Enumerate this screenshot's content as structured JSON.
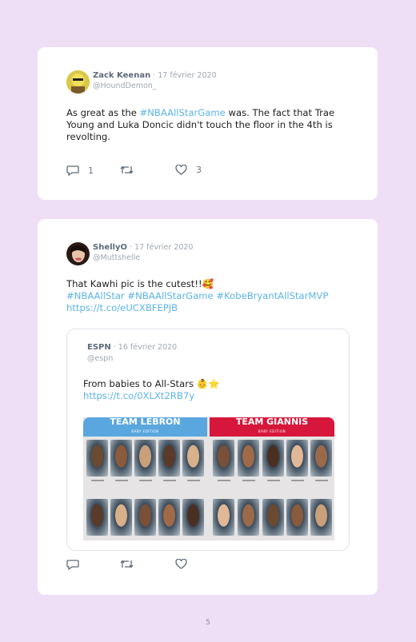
{
  "tweets": [
    {
      "name": "Zack Keenan",
      "date": " · 17 février 2020",
      "handle": "@HoundDemon_",
      "text_lines": [
        "As great as the ",
        "#NBAAllStarGame",
        " was. The fact that Trae",
        "Young and Luka Doncic didn't touch the floor in the 4th is",
        "revolting."
      ],
      "reply_count": "1",
      "like_count": "3"
    },
    {
      "name": "ShellyO",
      "date": " · 17 février 2020",
      "handle": "@Muttshelle",
      "text_line1": "That Kawhi pic is the cutest!!🥰",
      "hashtags": "#NBAAllStar #NBAAllStarGame #KobeBryantAllStarMVP",
      "link": "https://t.co/eUCXBFEPJB",
      "quoted": {
        "name": "ESPN",
        "date": " · 16 février 2020",
        "handle": "@espn",
        "text": "From babies to All-Stars 👶⭐",
        "link": "https://t.co/0XLXt2RB7y",
        "media": {
          "left_team": "TEAM LEBRON",
          "right_team": "TEAM GIANNIS",
          "subtitle": "BABY EDITION",
          "left_color": "#5aa6de",
          "right_color": "#d6173b"
        }
      }
    }
  ],
  "icons": {
    "reply": "reply-icon",
    "retweet": "retweet-icon",
    "like": "heart-icon"
  },
  "colors": {
    "background": "#eedff7",
    "link": "#5cb4e8",
    "card": "#ffffff"
  },
  "page_number": "5"
}
